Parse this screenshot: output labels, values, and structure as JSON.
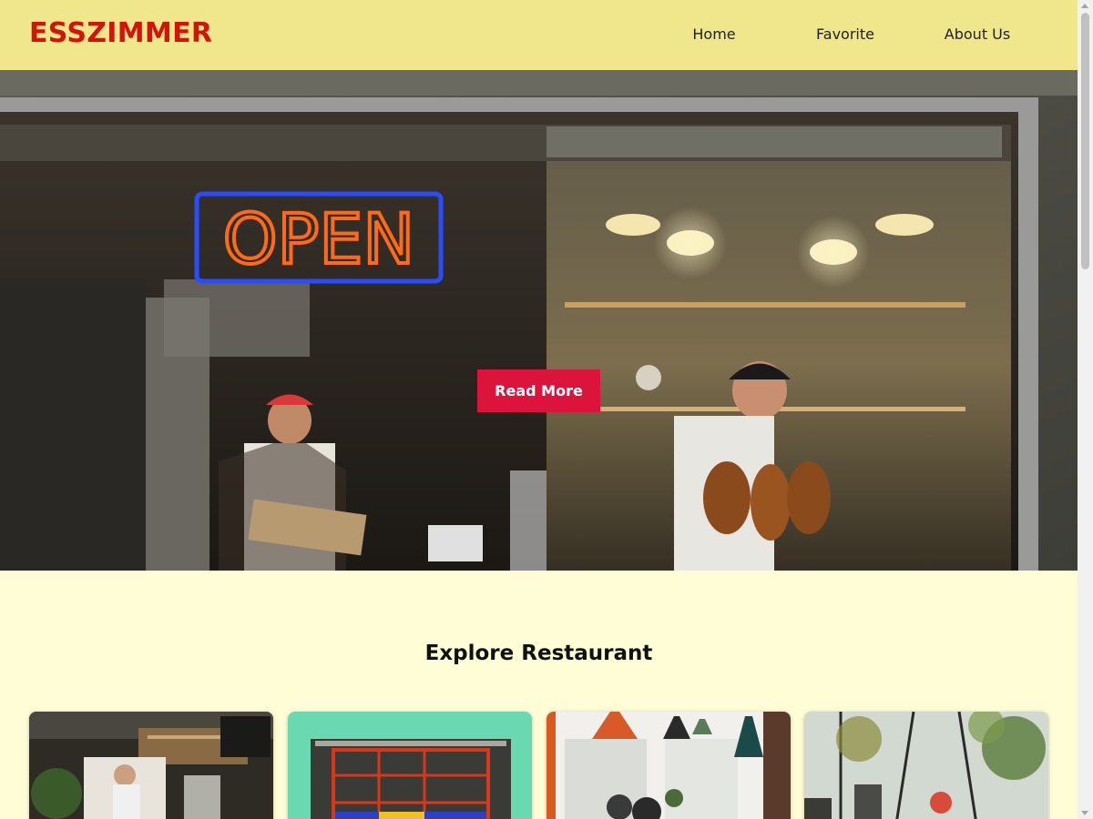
{
  "brand": {
    "name": "ESSZIMMER",
    "color": "#d2140a"
  },
  "nav": {
    "items": [
      {
        "label": "Home"
      },
      {
        "label": "Favorite"
      },
      {
        "label": "About Us"
      }
    ]
  },
  "hero": {
    "image": "restaurant-kitchen-with-open-neon-sign",
    "neon_sign": "OPEN",
    "button_label": "Read More",
    "button_color": "#dc143c"
  },
  "explore": {
    "title": "Explore Restaurant",
    "cards": [
      {
        "image": "cafe-interior-with-barista"
      },
      {
        "image": "green-storefront-with-red-window"
      },
      {
        "image": "bright-dining-room-with-pendant-lamps"
      },
      {
        "image": "greenhouse-dining-with-plants"
      }
    ]
  },
  "colors": {
    "header_bg": "#f0e68c",
    "page_bg": "#fffdd6"
  }
}
